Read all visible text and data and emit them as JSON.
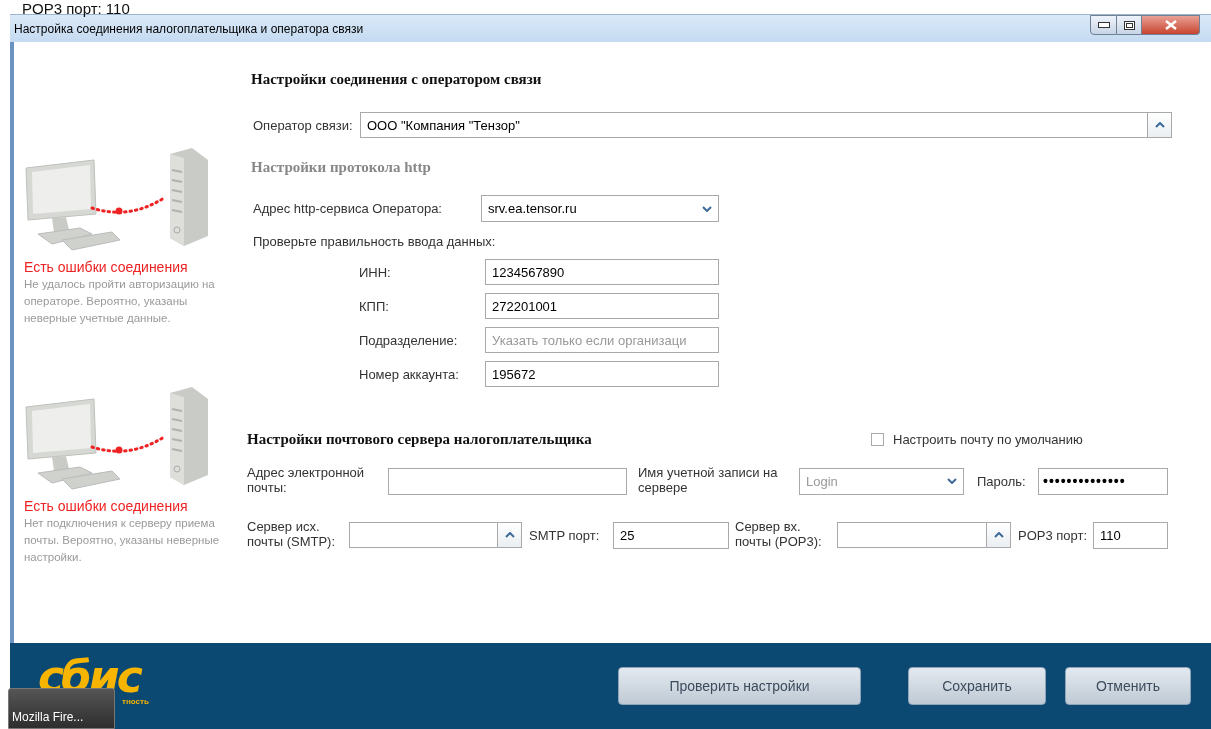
{
  "screen_fragment": {
    "text": "POP3 порт: 110"
  },
  "window": {
    "title": "Настройка соединения налогоплательщика и оператора связи"
  },
  "status_panels": [
    {
      "title": "Есть ошибки соединения",
      "description": "Не удалось пройти авторизацию на операторе. Вероятно, указаны неверные учетные данные.",
      "error": true
    },
    {
      "title": "Есть ошибки соединения",
      "description": "Нет подключения к серверу приема почты. Вероятно, указаны неверные настройки.",
      "error": true
    }
  ],
  "operator_section": {
    "heading": "Настройки соединения с оператором связи",
    "operator": {
      "label": "Оператор связи:",
      "value": "ООО \"Компания \"Тензор\""
    },
    "protocol_heading": "Настройки  протокола http",
    "http_address": {
      "label": "Адрес http-сервиса Оператора:",
      "value": "srv.ea.tensor.ru"
    },
    "check_hint": "Проверьте правильность ввода данных:",
    "fields": [
      {
        "label": "ИНН:",
        "value": "1234567890"
      },
      {
        "label": "КПП:",
        "value": "272201001"
      },
      {
        "label": "Подразделение:",
        "placeholder": "Указать только если организаци"
      },
      {
        "label": "Номер аккаунта:",
        "value": "195672"
      }
    ]
  },
  "mail_section": {
    "heading": "Настройки почтового сервера налогоплательщика",
    "default_mail": {
      "label": "Настроить почту по умолчанию",
      "checked": false
    },
    "email": {
      "label": "Адрес электронной почты:"
    },
    "account": {
      "label": "Имя учетной записи на сервере",
      "placeholder": "Login"
    },
    "password": {
      "label": "Пароль:",
      "value": "••••••••••••••"
    },
    "smtp_server": {
      "label": "Сервер исх. почты (SMTP):"
    },
    "smtp_port": {
      "label": "SMTP порт:",
      "value": "25"
    },
    "pop3_server": {
      "label": "Сервер вх. почты (POP3):"
    },
    "pop3_port": {
      "label": "POP3 порт:",
      "value": "110"
    }
  },
  "footer": {
    "logo": "сбис",
    "logo_tagline": "тность",
    "buttons": [
      {
        "label": "Проверить настройки"
      },
      {
        "label": "Сохранить"
      },
      {
        "label": "Отменить"
      }
    ]
  },
  "taskbar_thumbnail": {
    "label": "Mozilla Fire..."
  }
}
